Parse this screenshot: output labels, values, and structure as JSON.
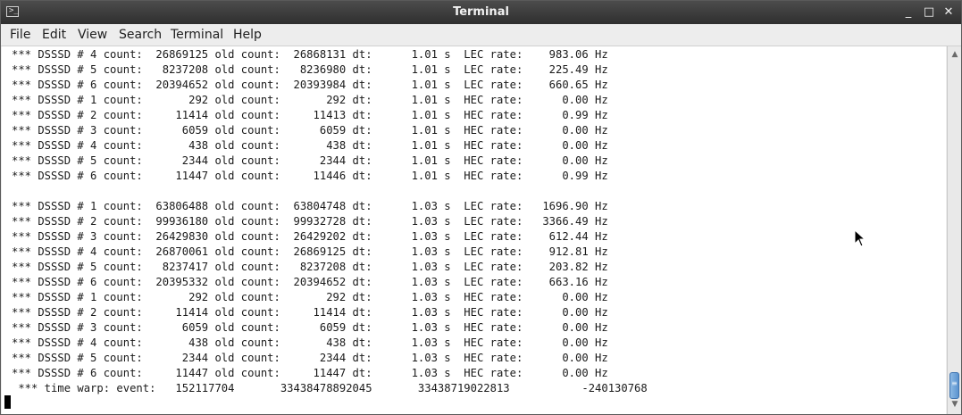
{
  "window": {
    "title": "Terminal"
  },
  "titlebar": {
    "app_icon": "terminal-icon",
    "minimize": "_",
    "maximize": "□",
    "close": "✕"
  },
  "menu": {
    "items": [
      "File",
      "Edit",
      "View",
      "Search",
      "Terminal",
      "Help"
    ]
  },
  "terminal": {
    "lines": [
      "*** DSSSD # 4 count:  26869125 old count:  26868131 dt:      1.01 s  LEC rate:    983.06 Hz",
      "*** DSSSD # 5 count:   8237208 old count:   8236980 dt:      1.01 s  LEC rate:    225.49 Hz",
      "*** DSSSD # 6 count:  20394652 old count:  20393984 dt:      1.01 s  LEC rate:    660.65 Hz",
      "*** DSSSD # 1 count:       292 old count:       292 dt:      1.01 s  HEC rate:      0.00 Hz",
      "*** DSSSD # 2 count:     11414 old count:     11413 dt:      1.01 s  HEC rate:      0.99 Hz",
      "*** DSSSD # 3 count:      6059 old count:      6059 dt:      1.01 s  HEC rate:      0.00 Hz",
      "*** DSSSD # 4 count:       438 old count:       438 dt:      1.01 s  HEC rate:      0.00 Hz",
      "*** DSSSD # 5 count:      2344 old count:      2344 dt:      1.01 s  HEC rate:      0.00 Hz",
      "*** DSSSD # 6 count:     11447 old count:     11446 dt:      1.01 s  HEC rate:      0.99 Hz",
      "",
      "*** DSSSD # 1 count:  63806488 old count:  63804748 dt:      1.03 s  LEC rate:   1696.90 Hz",
      "*** DSSSD # 2 count:  99936180 old count:  99932728 dt:      1.03 s  LEC rate:   3366.49 Hz",
      "*** DSSSD # 3 count:  26429830 old count:  26429202 dt:      1.03 s  LEC rate:    612.44 Hz",
      "*** DSSSD # 4 count:  26870061 old count:  26869125 dt:      1.03 s  LEC rate:    912.81 Hz",
      "*** DSSSD # 5 count:   8237417 old count:   8237208 dt:      1.03 s  LEC rate:    203.82 Hz",
      "*** DSSSD # 6 count:  20395332 old count:  20394652 dt:      1.03 s  LEC rate:    663.16 Hz",
      "*** DSSSD # 1 count:       292 old count:       292 dt:      1.03 s  HEC rate:      0.00 Hz",
      "*** DSSSD # 2 count:     11414 old count:     11414 dt:      1.03 s  HEC rate:      0.00 Hz",
      "*** DSSSD # 3 count:      6059 old count:      6059 dt:      1.03 s  HEC rate:      0.00 Hz",
      "*** DSSSD # 4 count:       438 old count:       438 dt:      1.03 s  HEC rate:      0.00 Hz",
      "*** DSSSD # 5 count:      2344 old count:      2344 dt:      1.03 s  HEC rate:      0.00 Hz",
      "*** DSSSD # 6 count:     11447 old count:     11447 dt:      1.03 s  HEC rate:      0.00 Hz",
      " *** time warp: event:   152117704       33438478892045       33438719022813           -240130768"
    ]
  },
  "scrollbar": {
    "up_icon": "▲",
    "down_icon": "▼",
    "thumb_grip": "≡",
    "position": 0.97
  },
  "colors": {
    "titlebar": "#3a3a3a",
    "scroll_thumb": "#5b93cf",
    "terminal_bg": "#ffffff"
  }
}
